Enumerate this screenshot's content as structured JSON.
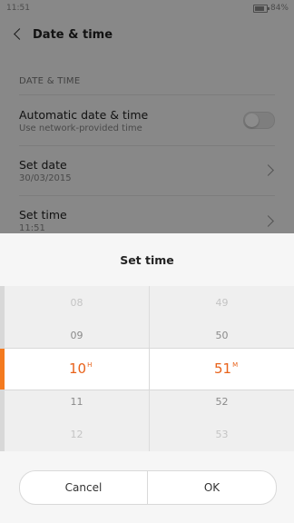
{
  "status_bar": {
    "time": "11:51",
    "battery": "84%",
    "battery_level": 0.84
  },
  "header": {
    "title": "Date & time"
  },
  "settings": {
    "section_header": "DATE & TIME",
    "rows": [
      {
        "label": "Automatic date & time",
        "sub": "Use network-provided time",
        "toggle_on": false
      },
      {
        "label": "Set date",
        "sub": "30/03/2015"
      },
      {
        "label": "Set time",
        "sub": "11:51"
      }
    ]
  },
  "dialog": {
    "title": "Set time",
    "hours": {
      "above2": "08",
      "above1": "09",
      "selected": "10",
      "unit": "H",
      "below1": "11",
      "below2": "12"
    },
    "minutes": {
      "above2": "49",
      "above1": "50",
      "selected": "51",
      "unit": "M",
      "below1": "52",
      "below2": "53"
    },
    "cancel_label": "Cancel",
    "ok_label": "OK"
  },
  "colors": {
    "accent": "#e8621a",
    "scrim": "rgba(0,0,0,0.45)"
  }
}
